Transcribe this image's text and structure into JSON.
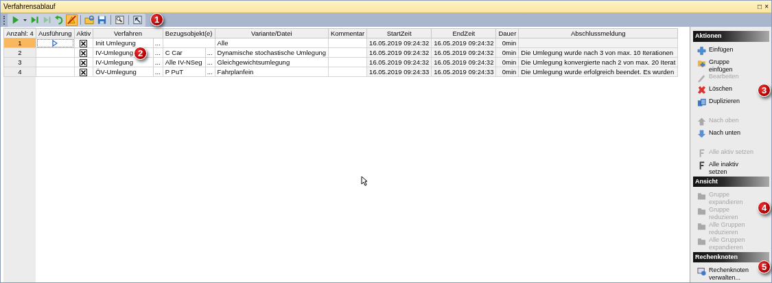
{
  "window": {
    "title": "Verfahrensablauf",
    "buttons": [
      "□",
      "×"
    ]
  },
  "toolbar": {
    "buttons": [
      {
        "kind": "play",
        "disabled": false,
        "pressed": false
      },
      {
        "kind": "caret",
        "disabled": false,
        "pressed": false
      },
      {
        "kind": "step",
        "disabled": false,
        "pressed": false
      },
      {
        "kind": "step",
        "disabled": true,
        "pressed": false
      },
      {
        "kind": "undo",
        "disabled": false,
        "pressed": false
      },
      {
        "kind": "erase",
        "disabled": false,
        "pressed": true
      },
      {
        "kind": "open",
        "disabled": false,
        "pressed": false
      },
      {
        "kind": "save",
        "disabled": false,
        "pressed": false
      },
      {
        "kind": "inspect",
        "disabled": false,
        "pressed": false
      },
      {
        "kind": "tool",
        "disabled": false,
        "pressed": false
      }
    ]
  },
  "table": {
    "columns": [
      "Anzahl: 4",
      "Ausführung",
      "Aktiv",
      "Verfahren",
      "Bezugsobjekt(e)",
      "Variante/Datei",
      "Kommentar",
      "StartZeit",
      "EndZeit",
      "Dauer",
      "Abschlussmeldung"
    ],
    "rows": [
      {
        "number": "1",
        "selected": true,
        "current": true,
        "active": true,
        "procedure": "Init Umlegung",
        "procedure_button": "...",
        "variant": "Alle",
        "start": "16.05.2019 09:24:32",
        "end": "16.05.2019 09:24:32",
        "duration": "0min"
      },
      {
        "number": "2",
        "selected": false,
        "current": false,
        "active": true,
        "procedure": "IV-Umlegung",
        "procedure_button": "...",
        "reference": "C Car",
        "reference_button": "...",
        "variant": "Dynamische stochastische Umlegung",
        "start": "16.05.2019 09:24:32",
        "end": "16.05.2019 09:24:32",
        "duration": "0min",
        "message": "Die Umlegung wurde nach 3 von max. 10 Iterationen"
      },
      {
        "number": "3",
        "selected": false,
        "current": false,
        "active": true,
        "procedure": "IV-Umlegung",
        "procedure_button": "...",
        "reference": "Alle IV-NSeg",
        "reference_button": "...",
        "variant": "Gleichgewichtsumlegung",
        "start": "16.05.2019 09:24:32",
        "end": "16.05.2019 09:24:32",
        "duration": "0min",
        "message": "Die Umlegung konvergierte nach 2 von max. 20 Iterat"
      },
      {
        "number": "4",
        "selected": false,
        "current": false,
        "active": true,
        "procedure": "ÖV-Umlegung",
        "procedure_button": "...",
        "reference": "P PuT",
        "reference_button": "...",
        "variant": "Fahrplanfein",
        "start": "16.05.2019 09:24:33",
        "end": "16.05.2019 09:24:33",
        "duration": "0min",
        "message": "Die Umlegung wurde erfolgreich beendet. Es wurden"
      }
    ]
  },
  "panel": {
    "sections": [
      {
        "title": "Aktionen",
        "items": [
          {
            "kind": "plus",
            "label": "Einfügen",
            "disabled": false
          },
          {
            "kind": "group",
            "label": "Gruppe einfügen",
            "disabled": false
          },
          {
            "kind": "pencil",
            "label": "Bearbeiten",
            "disabled": true
          },
          {
            "kind": "delete",
            "label": "Löschen",
            "disabled": false
          },
          {
            "kind": "copy",
            "label": "Duplizieren",
            "disabled": false
          },
          {
            "kind": "up",
            "label": "Nach oben",
            "disabled": true
          },
          {
            "kind": "down",
            "label": "Nach unten",
            "disabled": false
          },
          {
            "kind": "flag",
            "label": "Alle aktiv setzen",
            "disabled": true
          },
          {
            "kind": "flag",
            "label": "Alle inaktiv setzen",
            "disabled": false
          }
        ]
      },
      {
        "title": "Ansicht",
        "items": [
          {
            "kind": "folder",
            "label": "Gruppe expandieren",
            "disabled": true
          },
          {
            "kind": "folder",
            "label": "Gruppe reduzieren",
            "disabled": true
          },
          {
            "kind": "folder",
            "label": "Alle Gruppen reduzieren",
            "disabled": true
          },
          {
            "kind": "folder",
            "label": "Alle Gruppen expandieren",
            "disabled": true
          }
        ]
      },
      {
        "title": "Rechenknoten",
        "items": [
          {
            "kind": "node",
            "label": "Rechenknoten verwalten...",
            "disabled": false
          }
        ]
      }
    ]
  },
  "callouts": [
    "1",
    "2",
    "3",
    "4",
    "5"
  ]
}
